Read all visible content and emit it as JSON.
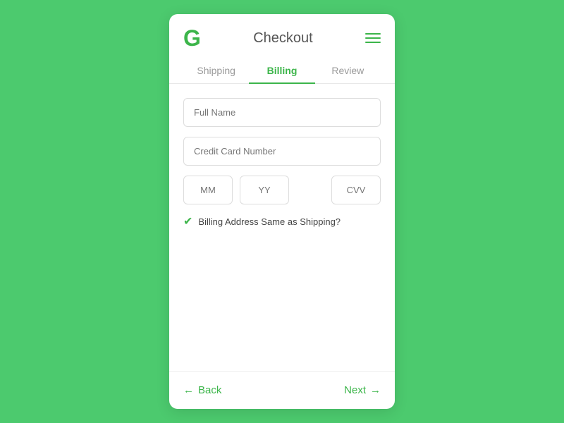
{
  "header": {
    "logo": "G",
    "title": "Checkout",
    "menu_icon_label": "menu"
  },
  "tabs": [
    {
      "id": "shipping",
      "label": "Shipping",
      "active": false
    },
    {
      "id": "billing",
      "label": "Billing",
      "active": true
    },
    {
      "id": "review",
      "label": "Review",
      "active": false
    }
  ],
  "form": {
    "full_name_placeholder": "Full Name",
    "credit_card_placeholder": "Credit Card Number",
    "mm_placeholder": "MM",
    "yy_placeholder": "YY",
    "cvv_placeholder": "CVV",
    "billing_same_label": "Billing Address Same as Shipping?"
  },
  "footer": {
    "back_label": "Back",
    "next_label": "Next",
    "back_arrow": "←",
    "next_arrow": "→"
  }
}
